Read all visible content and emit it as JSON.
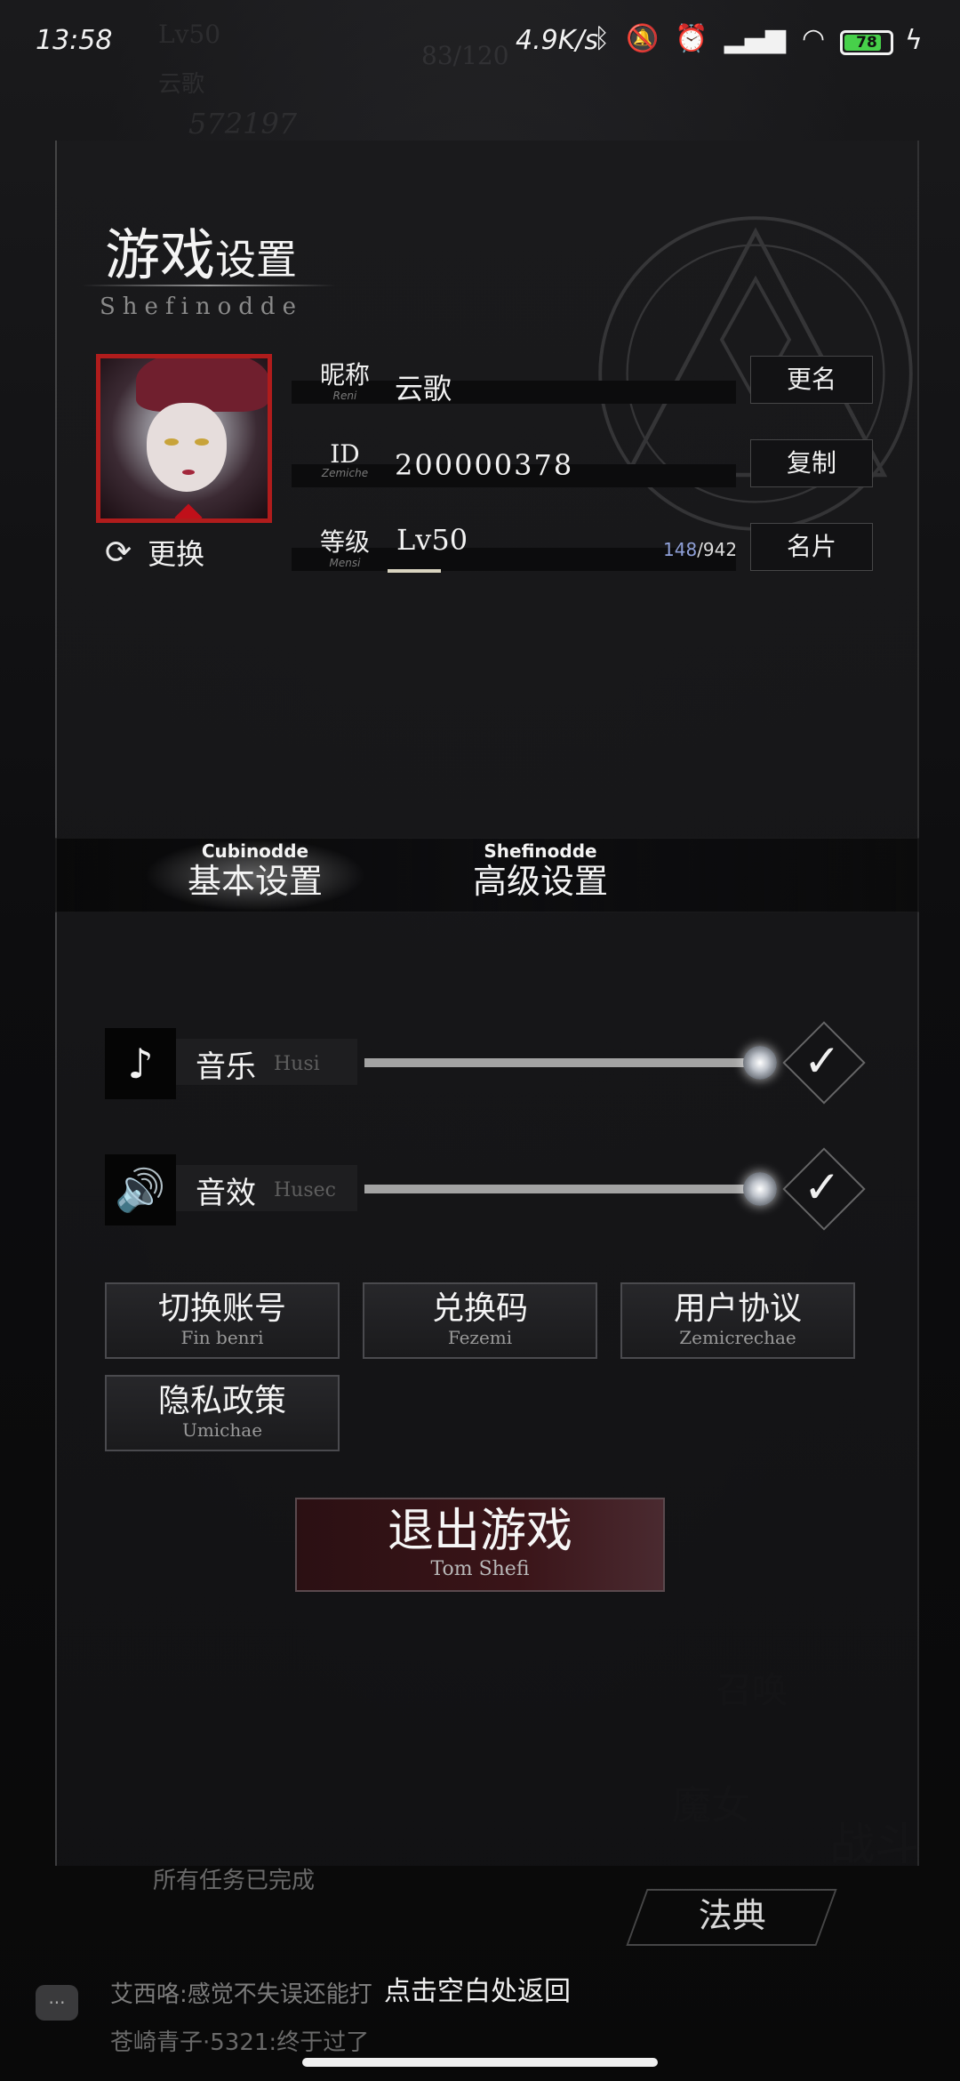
{
  "status_bar": {
    "time": "13:58",
    "net_speed": "4.9K/s",
    "battery": "78",
    "battery_level": 0.78,
    "icons": [
      "bluetooth-icon",
      "mute-icon",
      "alarm-icon",
      "hd-signal-icon",
      "wifi-icon",
      "charging-icon"
    ]
  },
  "background": {
    "top_left_level": "Lv50",
    "top_left_name": "云歌",
    "top_left_score": "572197",
    "stamina": "83/120",
    "summon": "召唤",
    "witch": "魔女",
    "battle": "战斗",
    "law_book": "法典"
  },
  "panel": {
    "title_big": "游戏",
    "title_small": "设置",
    "subtitle": "Shefinodde"
  },
  "profile": {
    "change_label": "更换",
    "nickname": {
      "label": "昵称",
      "label_en": "Reni",
      "value": "云歌",
      "button": "更名"
    },
    "id": {
      "label": "ID",
      "label_en": "Zemiche",
      "value": "200000378",
      "button": "复制"
    },
    "level": {
      "label": "等级",
      "label_en": "Mensi",
      "value": "Lv50",
      "exp_current": "148",
      "exp_total": "/942",
      "button": "名片",
      "exp_fraction": 0.157
    }
  },
  "tabs": [
    {
      "en": "Cubinodde",
      "cn": "基本设置",
      "active": true
    },
    {
      "en": "Shefinodde",
      "cn": "高级设置",
      "active": false
    }
  ],
  "sound": {
    "music": {
      "cn": "音乐",
      "en": "Husi",
      "level": 1.0,
      "enabled": true
    },
    "effects": {
      "cn": "音效",
      "en": "Husec",
      "level": 1.0,
      "enabled": true
    }
  },
  "menu": [
    {
      "cn": "切换账号",
      "en": "Fin benri"
    },
    {
      "cn": "兑换码",
      "en": "Fezemi"
    },
    {
      "cn": "用户协议",
      "en": "Zemicrechae"
    },
    {
      "cn": "隐私政策",
      "en": "Umichae"
    }
  ],
  "exit": {
    "cn": "退出游戏",
    "en": "Tom Shefi"
  },
  "bottom": {
    "task_text": "所有任务已完成",
    "chat_line_1": "艾西咯:感觉不失误还能打",
    "chat_line_2": "苍崎青子·5321:终于过了",
    "hint": "点击空白处返回"
  },
  "colors": {
    "accent_red": "#b01c1c",
    "exit_bg": "#3a1418",
    "exp_blue": "#8fa0d8",
    "battery_green": "#47d04a"
  }
}
